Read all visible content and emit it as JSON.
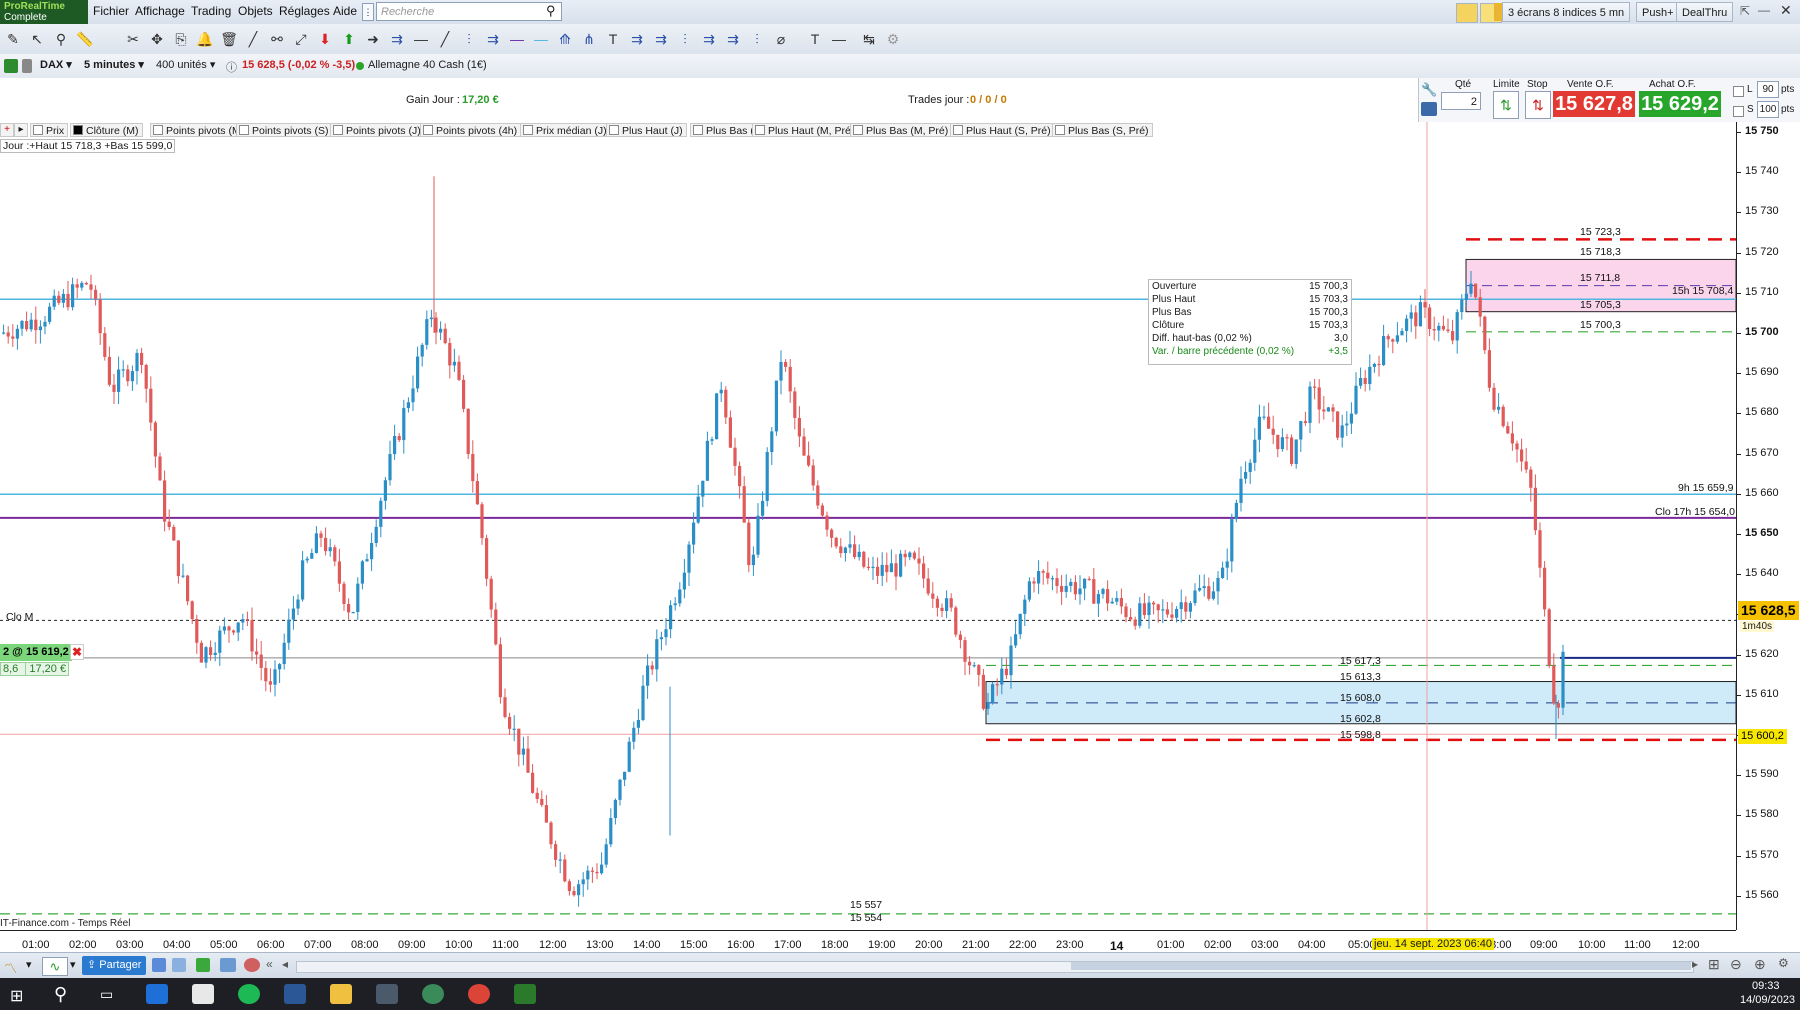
{
  "app": {
    "logo_line1": "ProRealTime",
    "logo_line2": "Complete"
  },
  "menu": [
    "Fichier",
    "Affichage",
    "Trading",
    "Objets",
    "Réglages",
    "Aide"
  ],
  "search": {
    "placeholder": "Recherche"
  },
  "topright": {
    "layout": "3 écrans 8 indices 5 mn",
    "push": "Push+",
    "dealthru": "DealThru"
  },
  "instrument": {
    "symbol": "DAX",
    "timeframe": "5 minutes",
    "units": "400 unités",
    "quote": "15 628,5 (-0,02 % -3,5)",
    "name": "Allemagne 40 Cash (1€)",
    "quote_color": "#cc2020"
  },
  "session": {
    "gain_label": "Gain Jour :",
    "gain_value": "17,20 €",
    "trades_label": "Trades jour :",
    "trades_value": "0 / 0 / 0"
  },
  "order_panel": {
    "qty_label": "Qté",
    "qty_value": "2",
    "limit_label": "Limite",
    "stop_label": "Stop",
    "sell_label": "Vente O.F.",
    "sell_price": "15 627,8",
    "buy_label": "Achat O.F.",
    "buy_price": "15 629,2",
    "l_label": "L",
    "l_value": "90",
    "s_label": "S",
    "s_value": "100",
    "pts": "pts"
  },
  "legend_items": [
    "Prix",
    "Clôture (M)",
    "Points pivots (M)",
    "Points pivots (S)",
    "Points pivots (J)",
    "Points pivots (4h)",
    "Prix médian (J)",
    "Plus Haut (J)",
    "Plus Bas (J)",
    "Plus Haut (M, Pré)",
    "Plus Bas (M, Pré)",
    "Plus Haut (S, Pré)",
    "Plus Bas (S, Pré)"
  ],
  "jour_label": "Jour :+Haut 15 718,3 +Bas 15 599,0",
  "ohlc_box": [
    {
      "label": "Ouverture",
      "value": "15 700,3"
    },
    {
      "label": "Plus Haut",
      "value": "15 703,3"
    },
    {
      "label": "Plus Bas",
      "value": "15 700,3"
    },
    {
      "label": "Clôture",
      "value": "15 703,3"
    },
    {
      "label": "Diff. haut-bas (0,02 %)",
      "value": "3,0"
    },
    {
      "label": "Var. / barre précédente (0,02 %)",
      "value": "+3,5"
    }
  ],
  "price_axis": [
    "15 750",
    "15 740",
    "15 730",
    "15 720",
    "15 710",
    "15 700",
    "15 690",
    "15 680",
    "15 670",
    "15 660",
    "15 650",
    "15 640",
    "15 630",
    "15 620",
    "15 610",
    "15 600",
    "15 590",
    "15 580",
    "15 570",
    "15 560"
  ],
  "price_tags": {
    "current": "15 628,5",
    "timer": "1m40s",
    "stop": "15 600,2"
  },
  "level_labels": {
    "l15723": "15 723,3",
    "l15718": "15 718,3",
    "l15711": "15 711,8",
    "l15708": "15h 15 708,4",
    "l15705": "15 705,3",
    "l15700": "15 700,3",
    "l9h": "9h 15 659,9",
    "clo17h": "Clo 17h 15 654,0",
    "clom": "Clo M",
    "l15617": "15 617,3",
    "l15613": "15 613,3",
    "l15608": "15 608,0",
    "l15602": "15 602,8",
    "l15598": "15 598,8",
    "l15557": "15 557",
    "l15554": "15 554"
  },
  "position": {
    "label": "2 @ 15 619,2",
    "pts": "8,6",
    "pnl": "17,20 €"
  },
  "time_axis": [
    "01:00",
    "02:00",
    "03:00",
    "04:00",
    "05:00",
    "06:00",
    "07:00",
    "08:00",
    "09:00",
    "10:00",
    "11:00",
    "12:00",
    "13:00",
    "14:00",
    "15:00",
    "16:00",
    "17:00",
    "18:00",
    "19:00",
    "20:00",
    "21:00",
    "22:00",
    "23:00",
    "14",
    "01:00",
    "02:00",
    "03:00",
    "04:00",
    "05:00",
    "08:00",
    "09:00",
    "10:00",
    "11:00",
    "12:00"
  ],
  "cursor_time": "jeu. 14 sept. 2023 06:40",
  "source_label": "IT-Finance.com - Temps Réel",
  "bottombar": {
    "share": "Partager"
  },
  "clock": {
    "time": "09:33",
    "date": "14/09/2023"
  },
  "colors": {
    "up": "#2b8fc7",
    "down": "#e05a5a",
    "red_dash": "#e01010",
    "green_dash": "#3aa83a",
    "blue_line": "#4fb6e0",
    "purple_line": "#7a2a9a",
    "zone_pink": "#fbd5ec",
    "zone_blue": "#cfeaf8"
  }
}
